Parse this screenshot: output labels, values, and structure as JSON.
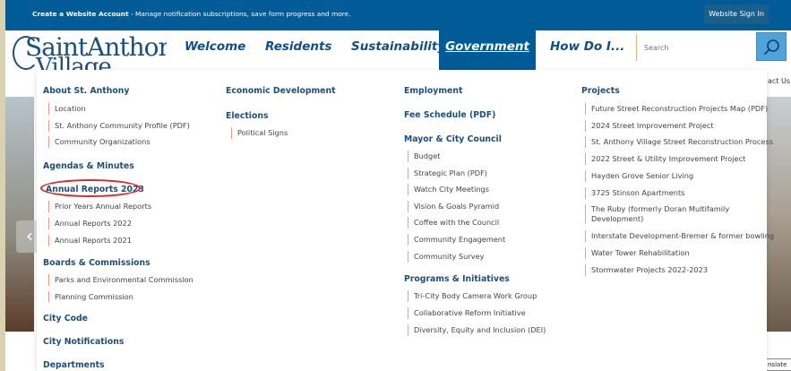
{
  "topbar": {
    "account_link": "Create a Website Account",
    "account_text": " - Manage notification subscriptions, save form progress and more.",
    "sign_in": "Website Sign In"
  },
  "logo": {
    "line1": "SaintAnthony",
    "line2": "Village"
  },
  "nav": {
    "items": [
      "Welcome",
      "Residents",
      "Sustainability",
      "Government",
      "How Do I..."
    ],
    "active": "Government"
  },
  "search": {
    "placeholder": "Search"
  },
  "page": {
    "contact": "act Us",
    "translate": "nslate"
  },
  "menu": {
    "col1": {
      "about": "About St. Anthony",
      "about_items": [
        "Location",
        "St. Anthony Community Profile (PDF)",
        "Community Organizations"
      ],
      "agendas": "Agendas & Minutes",
      "annual": "Annual Reports 2023",
      "annual_items": [
        "Prior Years Annual Reports",
        "Annual Reports 2022",
        "Annual Reports 2021"
      ],
      "boards": "Boards & Commissions",
      "boards_items": [
        "Parks and Environmental Commission",
        "Planning Commission"
      ],
      "code": "City Code",
      "notifications": "City Notifications",
      "departments": "Departments"
    },
    "col2": {
      "econ": "Economic Development",
      "elections": "Elections",
      "elections_items": [
        "Political Signs"
      ]
    },
    "col3": {
      "employment": "Employment",
      "fee": "Fee Schedule (PDF)",
      "mayor": "Mayor & City Council",
      "mayor_items": [
        "Budget",
        "Strategic Plan (PDF)",
        "Watch City Meetings",
        "Vision & Goals Pyramid",
        "Coffee with the Council",
        "Community Engagement",
        "Community Survey"
      ],
      "programs": "Programs & Initiatives",
      "programs_items": [
        "Tri-City Body Camera Work Group",
        "Collaborative Reform Initiative",
        "Diversity, Equity and Inclusion (DEI)"
      ]
    },
    "col4": {
      "projects": "Projects",
      "projects_items": [
        "Future Street Reconstruction Projects Map (PDF)",
        "2024 Street Improvement Project",
        "St. Anthony Village Street Reconstruction Process",
        "2022 Street & Utility Improvement Project",
        "Hayden Grove Senior Living",
        "3725 Stinson Apartments",
        "The Ruby (formerly Doran Multifamily Development)",
        "Interstate Development-Bremer & former bowling",
        "Water Tower Rehabilitation",
        "Stormwater Projects 2022-2023"
      ]
    }
  }
}
